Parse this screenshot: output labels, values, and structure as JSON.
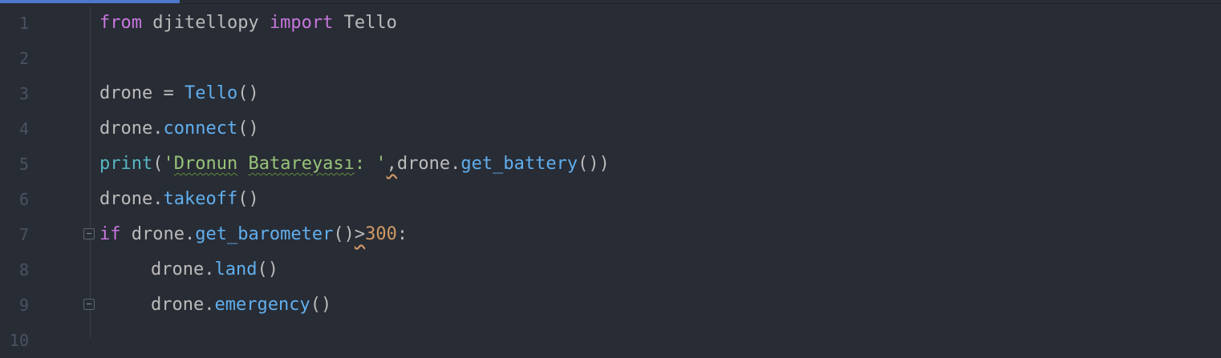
{
  "editor": {
    "line_numbers": [
      "1",
      "2",
      "3",
      "4",
      "5",
      "6",
      "7",
      "8",
      "9",
      "10"
    ],
    "lines": [
      {
        "tokens": [
          {
            "t": "from",
            "c": "kw"
          },
          {
            "t": " djitellopy ",
            "c": "var"
          },
          {
            "t": "import",
            "c": "kw"
          },
          {
            "t": " Tello",
            "c": "var"
          }
        ]
      },
      {
        "tokens": []
      },
      {
        "tokens": [
          {
            "t": "drone = ",
            "c": "var"
          },
          {
            "t": "Tello",
            "c": "cls"
          },
          {
            "t": "()",
            "c": "var"
          }
        ]
      },
      {
        "tokens": [
          {
            "t": "drone.",
            "c": "var"
          },
          {
            "t": "connect",
            "c": "fn"
          },
          {
            "t": "()",
            "c": "var"
          }
        ]
      },
      {
        "tokens": [
          {
            "t": "print",
            "c": "bi"
          },
          {
            "t": "(",
            "c": "var"
          },
          {
            "t": "'",
            "c": "str"
          },
          {
            "t": "Dronun",
            "c": "str typo"
          },
          {
            "t": " ",
            "c": "str"
          },
          {
            "t": "Batareyası",
            "c": "str typo"
          },
          {
            "t": ": '",
            "c": "str"
          },
          {
            "t": ",",
            "c": "var warn"
          },
          {
            "t": "drone.",
            "c": "var"
          },
          {
            "t": "get_battery",
            "c": "fn"
          },
          {
            "t": "())",
            "c": "var"
          }
        ]
      },
      {
        "tokens": [
          {
            "t": "drone.",
            "c": "var"
          },
          {
            "t": "takeoff",
            "c": "fn"
          },
          {
            "t": "()",
            "c": "var"
          }
        ]
      },
      {
        "tokens": [
          {
            "t": "if",
            "c": "kw"
          },
          {
            "t": " drone.",
            "c": "var"
          },
          {
            "t": "get_barometer",
            "c": "fn"
          },
          {
            "t": "()",
            "c": "var"
          },
          {
            "t": ">",
            "c": "var warn"
          },
          {
            "t": "300",
            "c": "num"
          },
          {
            "t": ":",
            "c": "var"
          }
        ]
      },
      {
        "indent": true,
        "tokens": [
          {
            "t": "drone.",
            "c": "var"
          },
          {
            "t": "land",
            "c": "fn"
          },
          {
            "t": "()",
            "c": "var"
          }
        ]
      },
      {
        "indent": true,
        "tokens": [
          {
            "t": "drone.",
            "c": "var"
          },
          {
            "t": "emergency",
            "c": "fn"
          },
          {
            "t": "()",
            "c": "var"
          }
        ]
      }
    ]
  }
}
